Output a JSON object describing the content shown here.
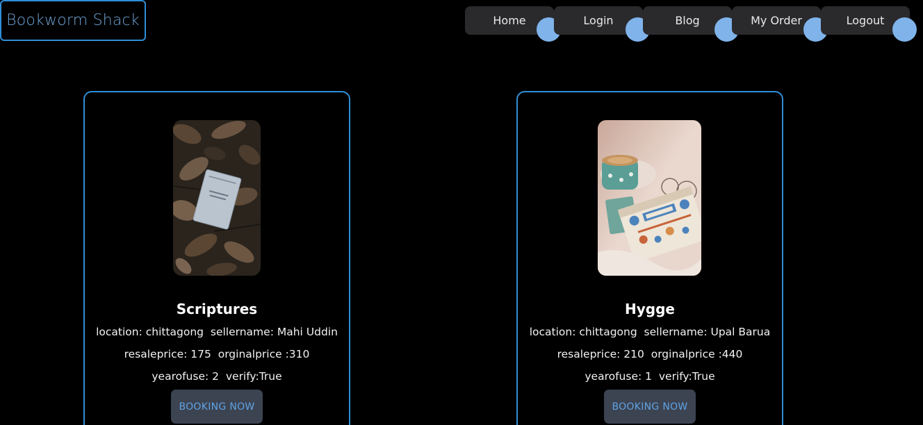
{
  "logo": {
    "text": "Bookworm Shack"
  },
  "nav": {
    "items": [
      {
        "label": "Home"
      },
      {
        "label": "Login"
      },
      {
        "label": "Blog"
      },
      {
        "label": "My Order"
      },
      {
        "label": "Logout"
      }
    ]
  },
  "books": [
    {
      "title": "Scriptures",
      "line1": "location: chittagong  sellername: Mahi Uddin",
      "line2": "resaleprice: 175  orginalprice :310",
      "line3": "yearofuse: 2  verify:True",
      "button": "BOOKING NOW"
    },
    {
      "title": "Hygge",
      "line1": "location: chittagong  sellername: Upal Barua",
      "line2": "resaleprice: 210  orginalprice :440",
      "line3": "yearofuse: 1  verify:True",
      "button": "BOOKING NOW"
    }
  ],
  "colors": {
    "accent_border": "#2f8fd8",
    "nav_bg": "#2a2a2d",
    "nav_dot": "#7fb3ea",
    "button_bg": "#3c4351",
    "button_text": "#5fa3e4"
  }
}
